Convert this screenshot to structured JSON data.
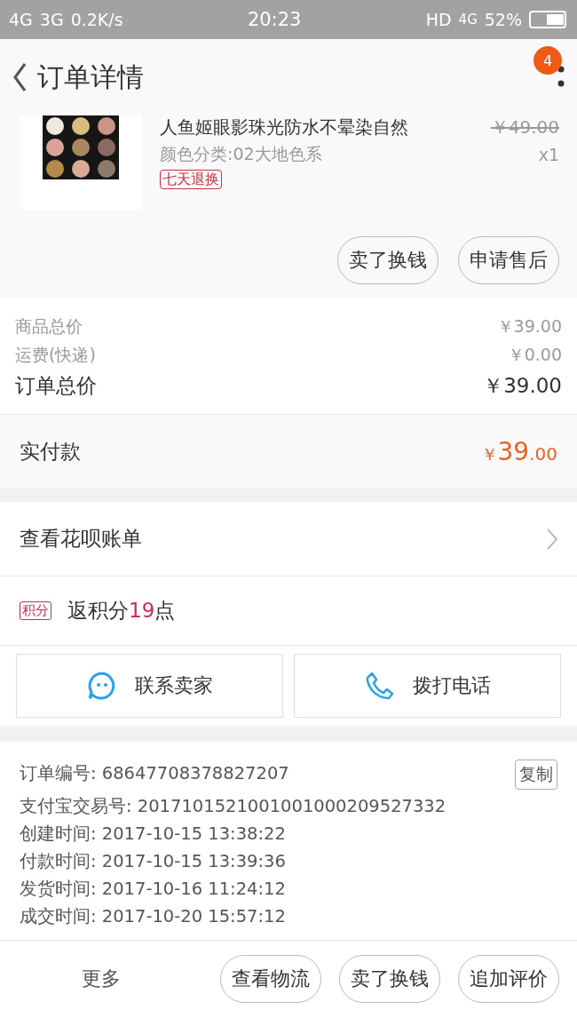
{
  "status_bar": {
    "left": [
      "4G",
      "3G",
      "0.2K/s"
    ],
    "time": "20:23",
    "network": "HD",
    "network_type": "4G",
    "battery": "52%"
  },
  "header": {
    "title": "订单详情",
    "badge": "4"
  },
  "product": {
    "name": "人鱼姬眼影珠光防水不晕染自然",
    "variant": "颜色分类:02大地色系",
    "tag": "七天退换",
    "original_price": "￥49.00",
    "quantity": "x1",
    "actions": [
      "卖了换钱",
      "申请售后"
    ]
  },
  "summary": [
    {
      "label": "商品总价",
      "value": "￥39.00",
      "emphasis": false
    },
    {
      "label": "运费(快递)",
      "value": "￥0.00",
      "emphasis": false
    },
    {
      "label": "订单总价",
      "value": "￥39.00",
      "emphasis": true
    }
  ],
  "paid": {
    "label": "实付款",
    "currency": "￥",
    "integer": "39",
    "decimal": ".00"
  },
  "huabei": {
    "label": "查看花呗账单"
  },
  "points": {
    "tag": "积分",
    "prefix": "返积分",
    "amount": "19",
    "suffix": "点"
  },
  "contact": [
    {
      "kind": "chat",
      "label": "联系卖家"
    },
    {
      "kind": "phone",
      "label": "拨打电话"
    }
  ],
  "order_info": {
    "copy": "复制",
    "lines": [
      {
        "label": "订单编号:",
        "value": "68647708378827207"
      },
      {
        "label": "支付宝交易号:",
        "value": "2017101521001001000209527332"
      },
      {
        "label": "创建时间:",
        "value": "2017-10-15 13:38:22"
      },
      {
        "label": "付款时间:",
        "value": "2017-10-15 13:39:36"
      },
      {
        "label": "发货时间:",
        "value": "2017-10-16 11:24:12"
      },
      {
        "label": "成交时间:",
        "value": "2017-10-20 15:57:12"
      }
    ]
  },
  "bottom_bar": {
    "more": "更多",
    "buttons": [
      "查看物流",
      "卖了换钱",
      "追加评价"
    ]
  }
}
